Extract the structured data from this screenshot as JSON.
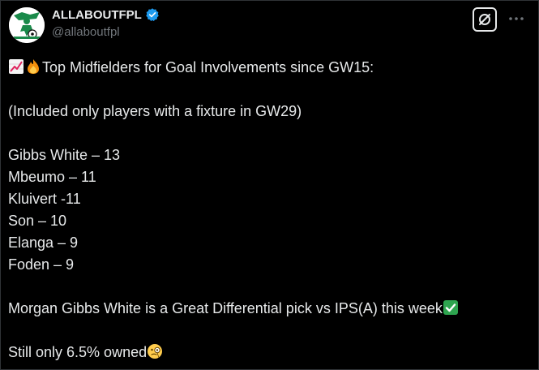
{
  "author": {
    "display_name": "ALLABOUTFPL",
    "handle": "@allaboutfpl",
    "verified": true,
    "avatar_icon": "football-logo-icon"
  },
  "actions": {
    "grok_icon": "grok-icon",
    "more_icon": "more-options-icon"
  },
  "colors": {
    "background": "#000000",
    "text": "#e7e9ea",
    "muted": "#71767b",
    "verified_blue": "#1d9bf0",
    "check_green": "#2ea44f"
  },
  "tweet": {
    "header_emojis": [
      "chart-increasing-icon",
      "fire-icon"
    ],
    "header_text": "Top Midfielders for Goal Involvements since GW15:",
    "note": "(Included only players with a fixture in GW29)",
    "players": [
      "Gibbs White – 13",
      "Mbeumo – 11",
      "Kluivert -11",
      "Son – 10",
      "Elanga – 9",
      "Foden – 9"
    ],
    "pick_text": "Morgan Gibbs White is a Great Differential pick vs IPS(A) this week",
    "pick_emoji": "check-mark-button-icon",
    "owned_text": "Still only 6.5% owned",
    "owned_emoji": "monocle-face-icon"
  }
}
